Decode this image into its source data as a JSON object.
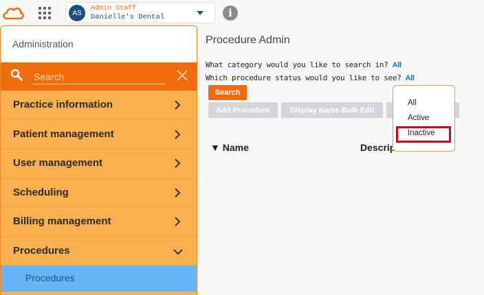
{
  "account": {
    "initials": "AS",
    "role": "Admin Staff",
    "practice": "Danielle's Dental"
  },
  "info_icon": "i",
  "sidebar": {
    "title": "Administration",
    "search_placeholder": "Search",
    "items": [
      {
        "label": "Practice information",
        "icon": "chevron-right"
      },
      {
        "label": "Patient management",
        "icon": "chevron-right"
      },
      {
        "label": "User management",
        "icon": "chevron-right"
      },
      {
        "label": "Scheduling",
        "icon": "chevron-right"
      },
      {
        "label": "Billing management",
        "icon": "chevron-right"
      },
      {
        "label": "Procedures",
        "icon": "chevron-down"
      }
    ],
    "sub_item": "Procedures"
  },
  "main": {
    "title": "Procedure Admin",
    "category_question": "What category would you like to search in?",
    "category_value": "All",
    "status_question": "Which procedure status would you like to see?",
    "status_value": "All",
    "search_button": "Search",
    "add_button": "Add Procedure",
    "bulk_button": "Display Name Bulk Edit",
    "table_headers": [
      "▼ Name",
      "Descrip"
    ]
  },
  "status_dropdown": {
    "options": [
      "All",
      "Active",
      "Inactive"
    ],
    "highlighted": "Inactive"
  },
  "colors": {
    "accent": "#ef6c0c",
    "sidebar_bg": "#fbb04f",
    "selected_sub": "#66b5f8",
    "highlight_box": "#d0021b"
  }
}
